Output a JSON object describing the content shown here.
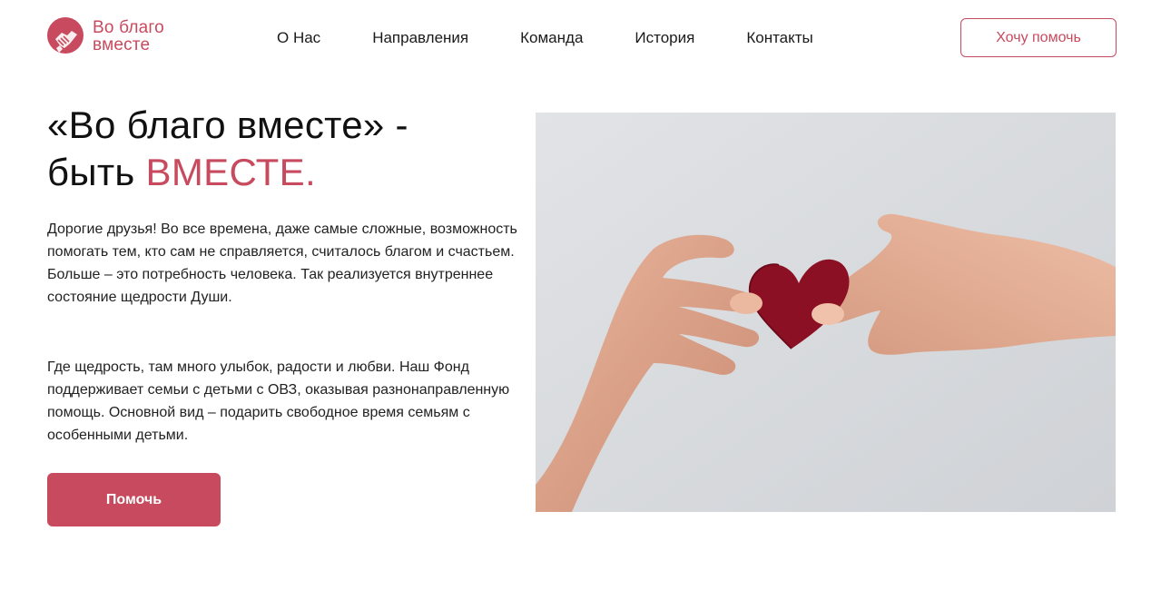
{
  "brand": {
    "line1": "Во благо",
    "line2": "вместе",
    "accent_color": "#c84a5e"
  },
  "nav": {
    "items": [
      {
        "label": "О Нас"
      },
      {
        "label": "Направления"
      },
      {
        "label": "Команда"
      },
      {
        "label": "История"
      },
      {
        "label": "Контакты"
      }
    ]
  },
  "header": {
    "cta_label": "Хочу помочь"
  },
  "hero": {
    "title_line1": "«Во благо вместе» -",
    "title_line2_prefix": "быть ",
    "title_line2_accent": "ВМЕСТЕ.",
    "paragraph1": "Дорогие друзья! Во все времена, даже самые сложные, возможность помогать тем, кто сам не справляется, считалось благом и счастьем. Больше – это потребность человека. Так реализуется внутреннее состояние щедрости Души.",
    "paragraph2": "Где щедрость, там много улыбок, радости и любви. Наш Фонд поддерживает семьи с детьми с ОВЗ, оказывая разнонаправленную помощь. Основной вид – подарить свободное время семьям с особенными детьми.",
    "button_label": "Помочь"
  },
  "photo": {
    "icon": "hands-heart-photo"
  }
}
